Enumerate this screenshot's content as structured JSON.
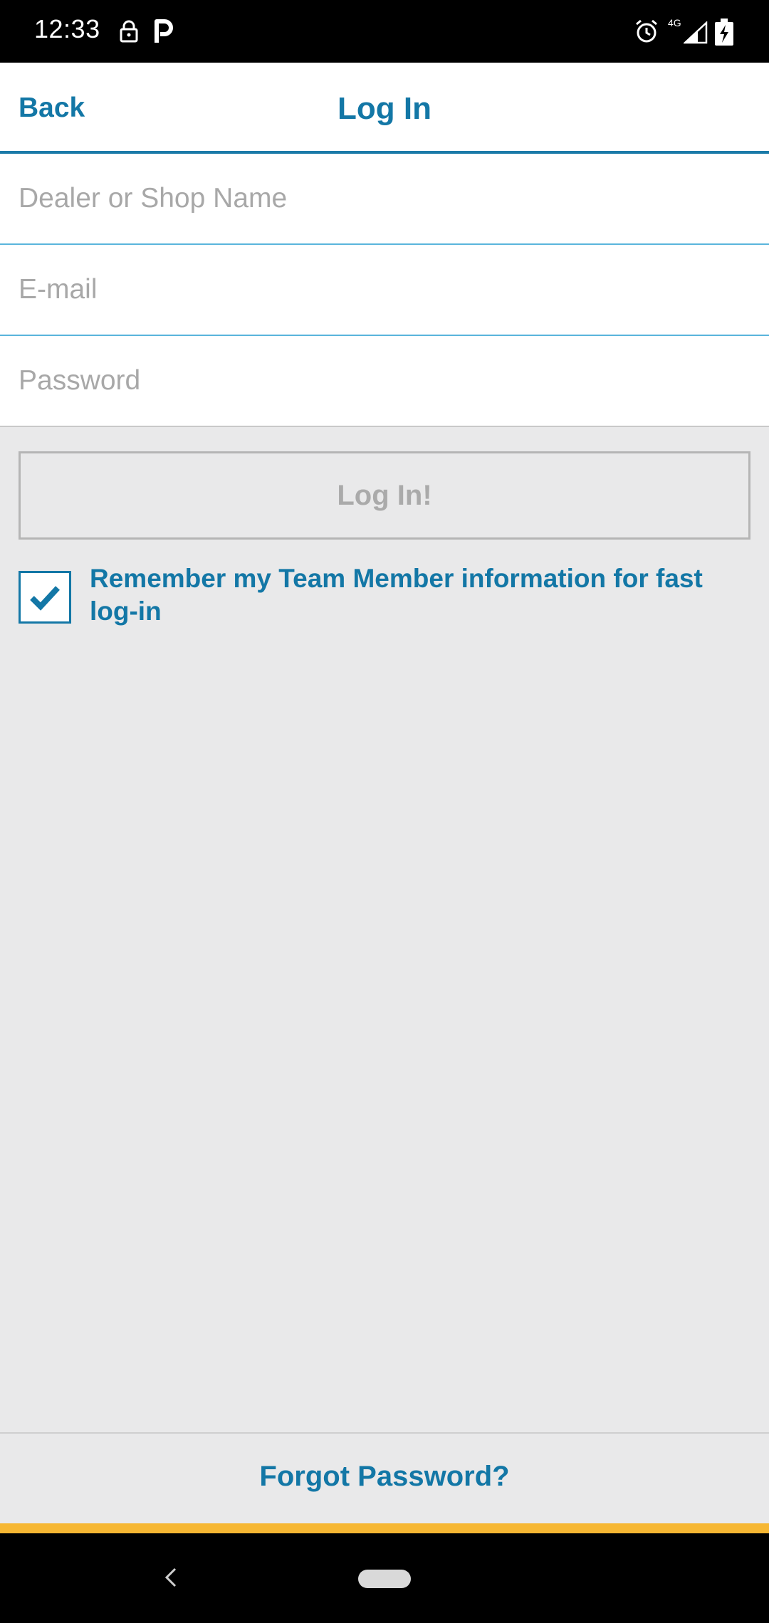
{
  "status_bar": {
    "time": "12:33",
    "network_label": "4G",
    "icons": [
      "lock-icon",
      "parking-icon",
      "alarm-icon",
      "signal-icon",
      "battery-charging-icon"
    ]
  },
  "header": {
    "back_label": "Back",
    "title": "Log In"
  },
  "form": {
    "dealer_placeholder": "Dealer or Shop Name",
    "dealer_value": "",
    "email_placeholder": "E-mail",
    "email_value": "",
    "password_placeholder": "Password",
    "password_value": "",
    "login_label": "Log In!",
    "remember_label": "Remember my Team Member information for fast log-in",
    "remember_checked": true
  },
  "footer": {
    "forgot_label": "Forgot Password?"
  },
  "colors": {
    "accent": "#1377a6",
    "field_divider": "#5ab5dc",
    "background": "#e9e9ea",
    "highlight_bar": "#f6b733"
  }
}
